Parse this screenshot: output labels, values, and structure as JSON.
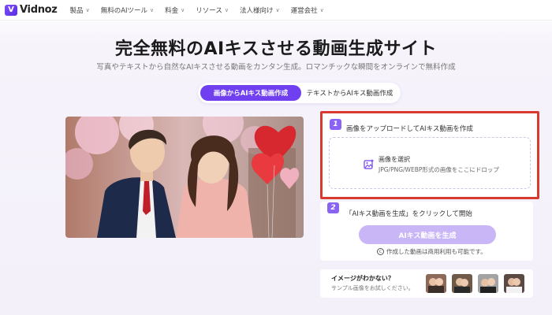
{
  "nav": {
    "logo": "Vidnoz",
    "items": [
      "製品",
      "無料のAIツール",
      "料金",
      "リソース",
      "法人様向け",
      "運営会社"
    ]
  },
  "hero": {
    "title": "完全無料のAIキスさせる動画生成サイト",
    "subtitle": "写真やテキストから自然なAIキスさせる動画をカンタン生成。ロマンチックな瞬間をオンラインで無料作成"
  },
  "tabs": {
    "active": "画像からAIキス動画作成",
    "inactive": "テキストからAIキス動画作成"
  },
  "step1": {
    "number": "1",
    "label": "画像をアップロードしてAIキス動画を作成",
    "select": "画像を選択",
    "hint": "JPG/PNG/WEBP形式の画像をここにドロップ"
  },
  "step2": {
    "number": "2",
    "label": "「AIキス動画を生成」をクリックして開始",
    "button": "AIキス動画を生成",
    "note": "作成した動画は商用利用も可能です。"
  },
  "samples": {
    "title": "イメージがわかない？",
    "subtitle": "サンプル画像をお試しください。"
  },
  "colors": {
    "accent": "#6f3ff0",
    "disabled_button": "#c8b6f7",
    "highlight_border": "#d93a2f"
  }
}
